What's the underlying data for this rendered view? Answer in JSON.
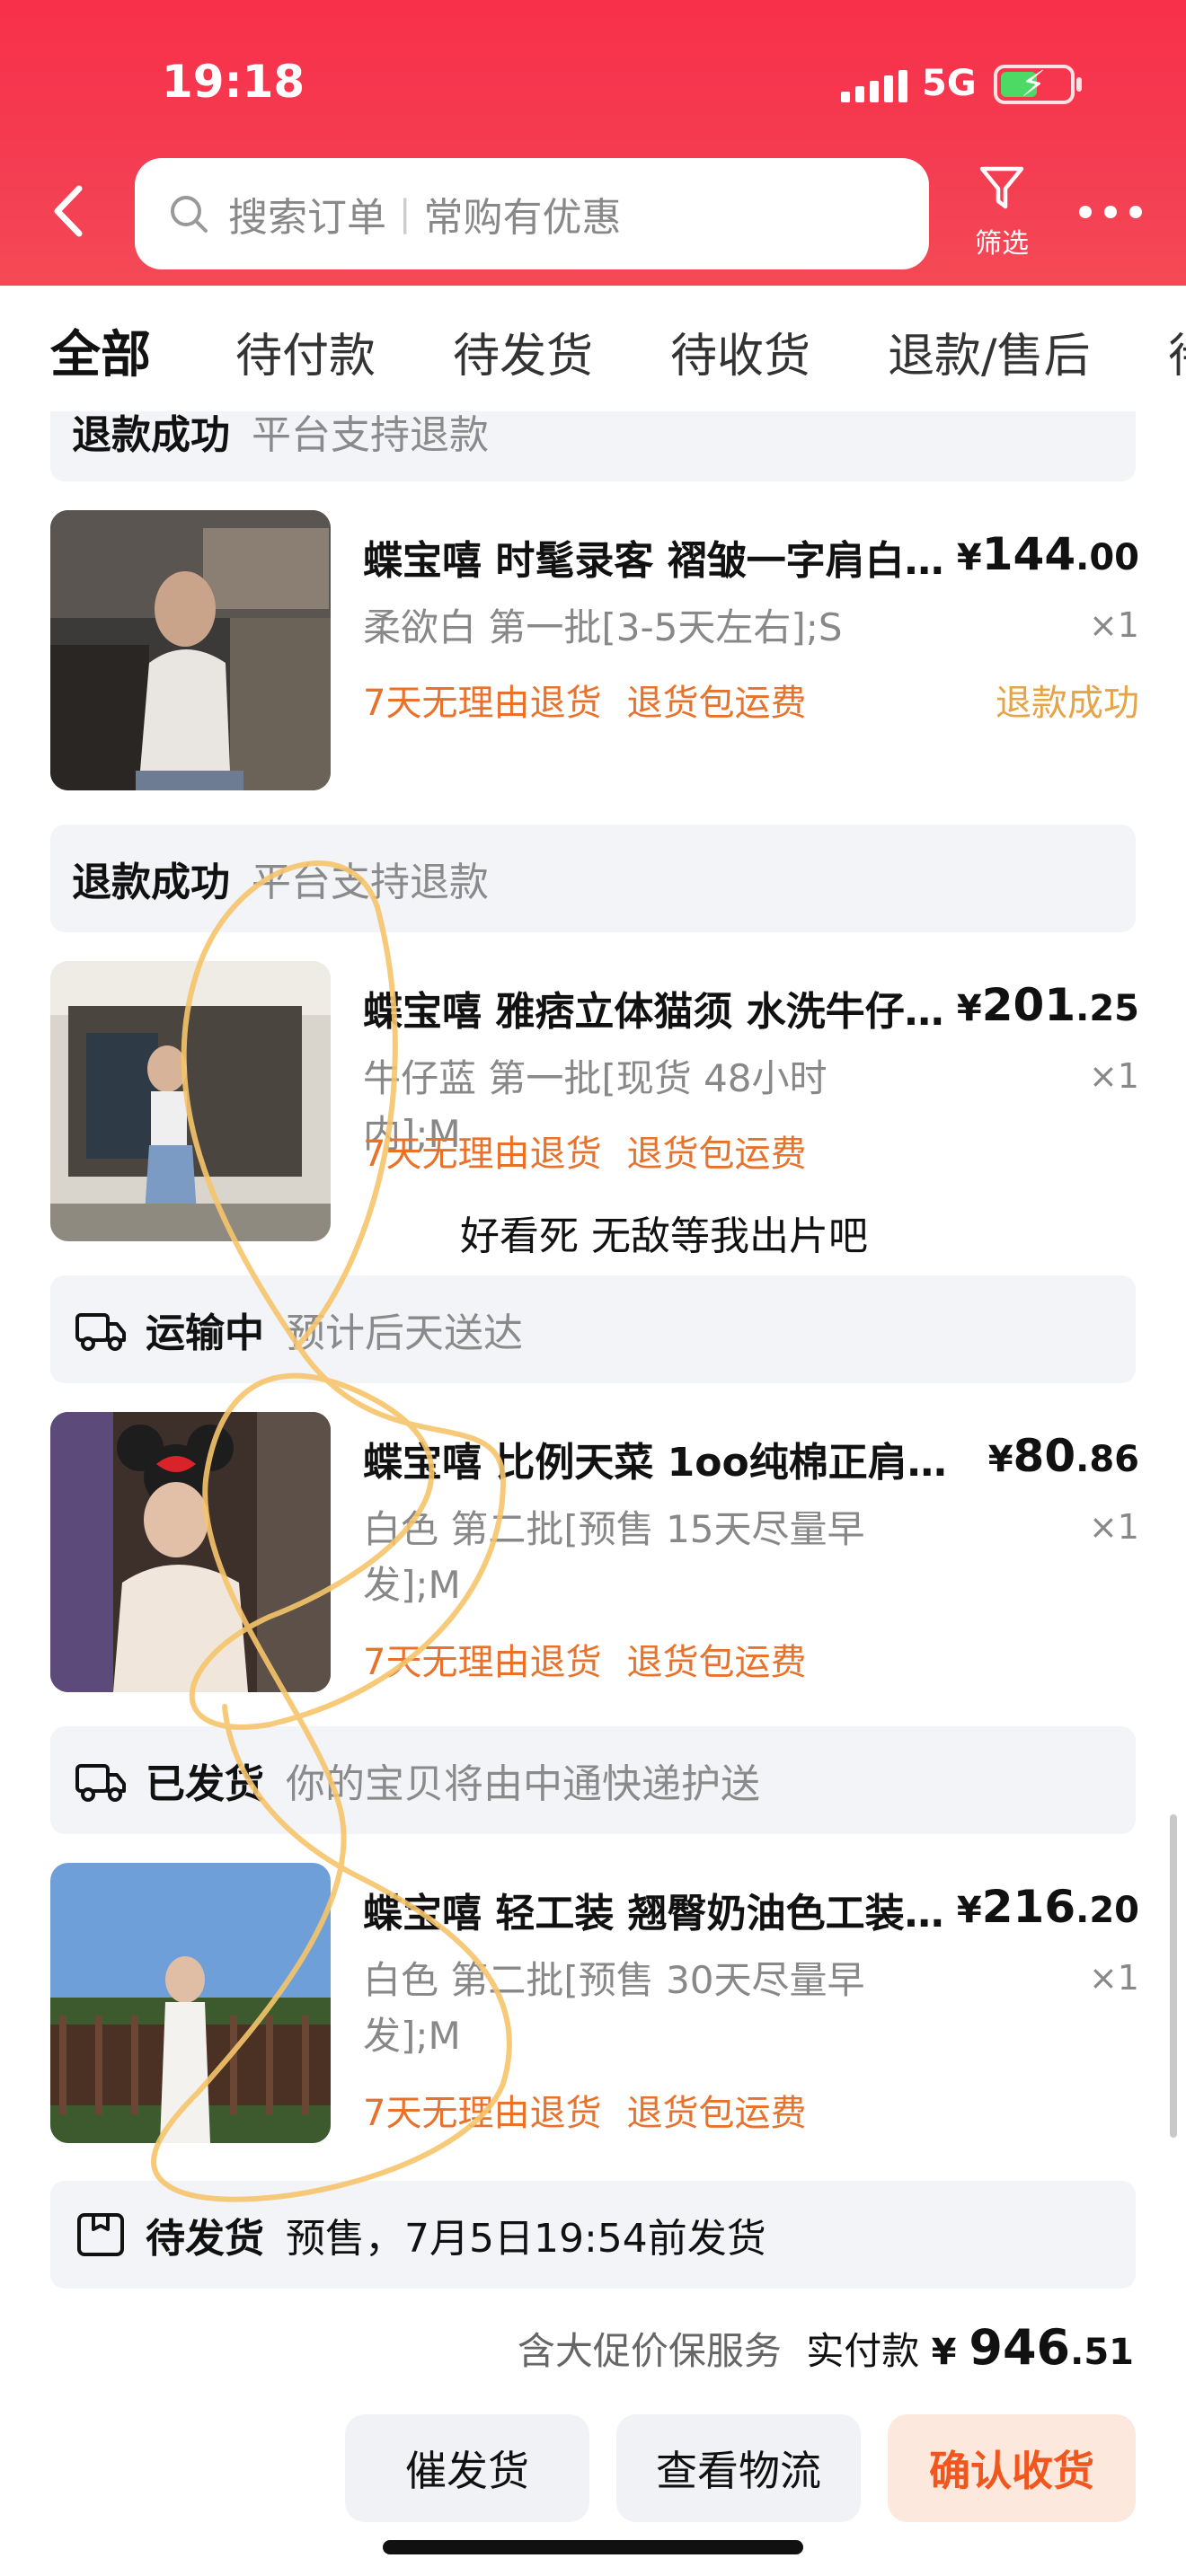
{
  "status_bar": {
    "time": "19:18",
    "network": "5G"
  },
  "header": {
    "search_placeholder_1": "搜索订单",
    "search_placeholder_2": "常购有优惠",
    "filter_label": "筛选"
  },
  "tabs": [
    {
      "label": "全部",
      "active": true
    },
    {
      "label": "待付款"
    },
    {
      "label": "待发货"
    },
    {
      "label": "待收货"
    },
    {
      "label": "退款/售后"
    },
    {
      "label": "待"
    }
  ],
  "orders": [
    {
      "status": "退款成功",
      "status_note": "平台支持退款",
      "title": "蝶宝嘻 时髦录客 褶皱一字肩白…",
      "price_symbol": "¥",
      "price_int": "144",
      "price_dec": ".00",
      "spec": "柔欲白 第一批[3-5天左右];S",
      "qty": "×1",
      "tag1": "7天无理由退货",
      "tag2": "退货包运费",
      "refund_state": "退款成功"
    },
    {
      "status": "退款成功",
      "status_note": "平台支持退款",
      "title": "蝶宝嘻 雅痞立体猫须 水洗牛仔…",
      "price_symbol": "¥",
      "price_int": "201",
      "price_dec": ".25",
      "spec": "牛仔蓝 第一批[现货 48小时内];M",
      "qty": "×1",
      "tag1": "7天无理由退货",
      "tag2": "退货包运费"
    },
    {
      "status": "运输中",
      "status_note": "预计后天送达",
      "title": "蝶宝嘻 比例天菜 1oo纯棉正肩…",
      "price_symbol": "¥",
      "price_int": "80",
      "price_dec": ".86",
      "spec": "白色 第二批[预售 15天尽量早发];M",
      "qty": "×1",
      "tag1": "7天无理由退货",
      "tag2": "退货包运费"
    },
    {
      "status": "已发货",
      "status_note": "你的宝贝将由中通快递护送",
      "title": "蝶宝嘻 轻工装 翘臀奶油色工装…",
      "price_symbol": "¥",
      "price_int": "216",
      "price_dec": ".20",
      "spec": "白色 第二批[预售 30天尽量早发];M",
      "qty": "×1",
      "tag1": "7天无理由退货",
      "tag2": "退货包运费"
    }
  ],
  "pending": {
    "status": "待发货",
    "note": "预售，7月5日19:54前发货"
  },
  "overlay_note": "好看死 无敌等我出片吧",
  "summary": {
    "service": "含大促价保服务",
    "pay_label": "实付款",
    "symbol": "¥",
    "amount_int": "946",
    "amount_dec": ".51"
  },
  "buttons": {
    "urge": "催发货",
    "logistics": "查看物流",
    "confirm": "确认收货"
  },
  "colors": {
    "header": "#f8304a",
    "tag_orange": "#e8722b",
    "refund_state": "#e5a447",
    "confirm": "#f0561e",
    "scribble": "#f5c46a"
  }
}
